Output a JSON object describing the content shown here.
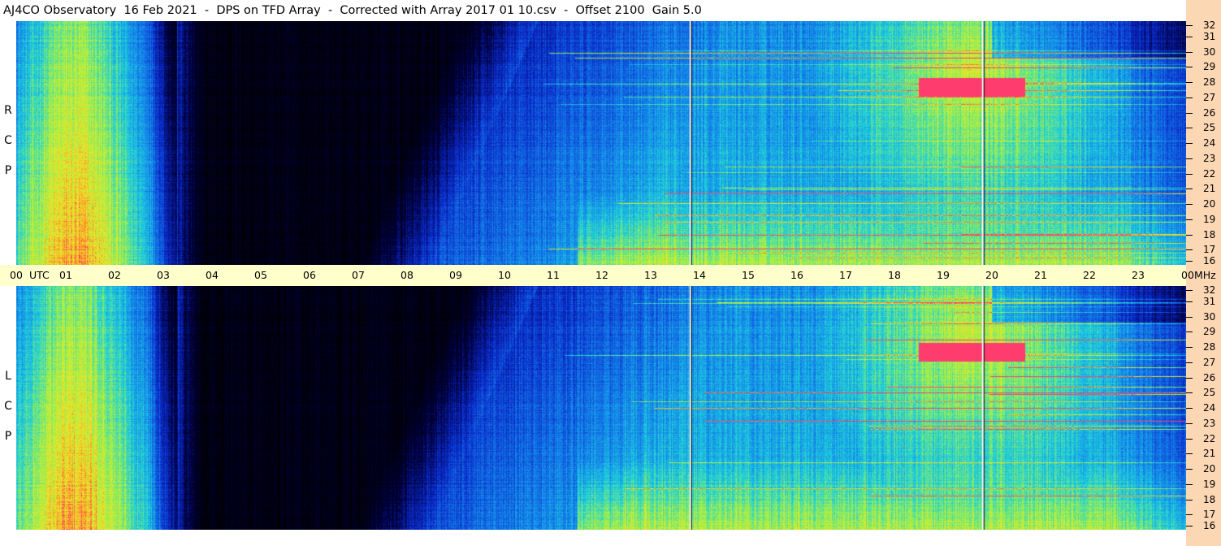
{
  "title": "AJ4CO Observatory  16 Feb 2021  -  DPS on TFD Array  -  Corrected with Array 2017 01 10.csv  -  Offset 2100  Gain 5.0",
  "panels": [
    {
      "label": [
        "R",
        "C",
        "P"
      ]
    },
    {
      "label": [
        "L",
        "C",
        "P"
      ]
    }
  ],
  "colors": {
    "background_dark": "#000000",
    "low": "#0a2ab0",
    "mid": "#1aa8e8",
    "high": "#b8f040",
    "peak": "#f0e020",
    "hot": "#ff4060",
    "axis_band": "#ffffcc",
    "freq_band": "#fcd7b4"
  },
  "chart_data": {
    "type": "heatmap",
    "title": "AJ4CO Observatory  16 Feb 2021  -  DPS on TFD Array  -  Corrected with Array 2017 01 10.csv  -  Offset 2100  Gain 5.0",
    "x": {
      "label": "UTC",
      "ticks": [
        "00",
        "01",
        "02",
        "03",
        "04",
        "05",
        "06",
        "07",
        "08",
        "09",
        "10",
        "11",
        "12",
        "13",
        "14",
        "15",
        "16",
        "17",
        "18",
        "19",
        "20",
        "21",
        "22",
        "23",
        "00"
      ],
      "range": [
        0,
        24
      ]
    },
    "y": {
      "label": "MHz",
      "ticks": [
        "16",
        "17",
        "18",
        "19",
        "20",
        "21",
        "22",
        "23",
        "24",
        "25",
        "26",
        "27",
        "28",
        "29",
        "30",
        "31",
        "32"
      ],
      "range": [
        16,
        32
      ]
    },
    "series": [
      {
        "name": "R C P"
      },
      {
        "name": "L C P"
      }
    ],
    "markers": {
      "vertical_lines_utc": [
        13.83,
        19.83
      ]
    },
    "grid": false
  }
}
